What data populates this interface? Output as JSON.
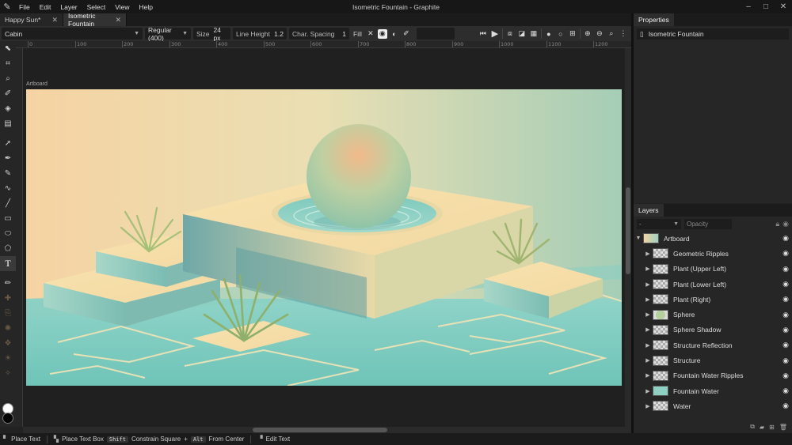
{
  "window": {
    "title": "Isometric Fountain - Graphite"
  },
  "menu": [
    "File",
    "Edit",
    "Layer",
    "Select",
    "View",
    "Help"
  ],
  "doc_tabs": [
    {
      "label": "Happy Sun*",
      "active": false
    },
    {
      "label": "Isometric Fountain",
      "active": true
    }
  ],
  "options": {
    "font": "Cabin",
    "weight": "Regular (400)",
    "size_label": "Size",
    "size_value": "24 px",
    "line_height_label": "Line Height",
    "line_height_value": "1.2",
    "char_spacing_label": "Char. Spacing",
    "char_spacing_value": "1",
    "fill_label": "Fill"
  },
  "ruler_ticks": [
    "0",
    "100",
    "200",
    "300",
    "400",
    "500",
    "600",
    "700",
    "800",
    "900",
    "1000",
    "1100",
    "1200"
  ],
  "canvas": {
    "artboard_label": "Artboard"
  },
  "properties": {
    "tab": "Properties",
    "document_name": "Isometric Fountain"
  },
  "layers": {
    "tab": "Layers",
    "blend_placeholder": "-",
    "opacity_placeholder": "Opacity",
    "items": [
      {
        "name": "Artboard",
        "level": 0,
        "expanded": true
      },
      {
        "name": "Geometric Ripples",
        "level": 1
      },
      {
        "name": "Plant (Upper Left)",
        "level": 1
      },
      {
        "name": "Plant (Lower Left)",
        "level": 1
      },
      {
        "name": "Plant (Right)",
        "level": 1
      },
      {
        "name": "Sphere",
        "level": 1
      },
      {
        "name": "Sphere Shadow",
        "level": 1
      },
      {
        "name": "Structure Reflection",
        "level": 1
      },
      {
        "name": "Structure",
        "level": 1
      },
      {
        "name": "Fountain Water Ripples",
        "level": 1
      },
      {
        "name": "Fountain Water",
        "level": 1
      },
      {
        "name": "Water",
        "level": 1
      }
    ]
  },
  "status": {
    "place_text": "Place Text",
    "place_text_box": "Place Text Box",
    "shift_key": "Shift",
    "constrain_square": "Constrain Square",
    "alt_key": "Alt",
    "from_center": "From Center",
    "edit_text": "Edit Text"
  },
  "colors": {
    "primary": "#ffffff",
    "secondary": "#000000",
    "accent": "#7fc8c0"
  }
}
